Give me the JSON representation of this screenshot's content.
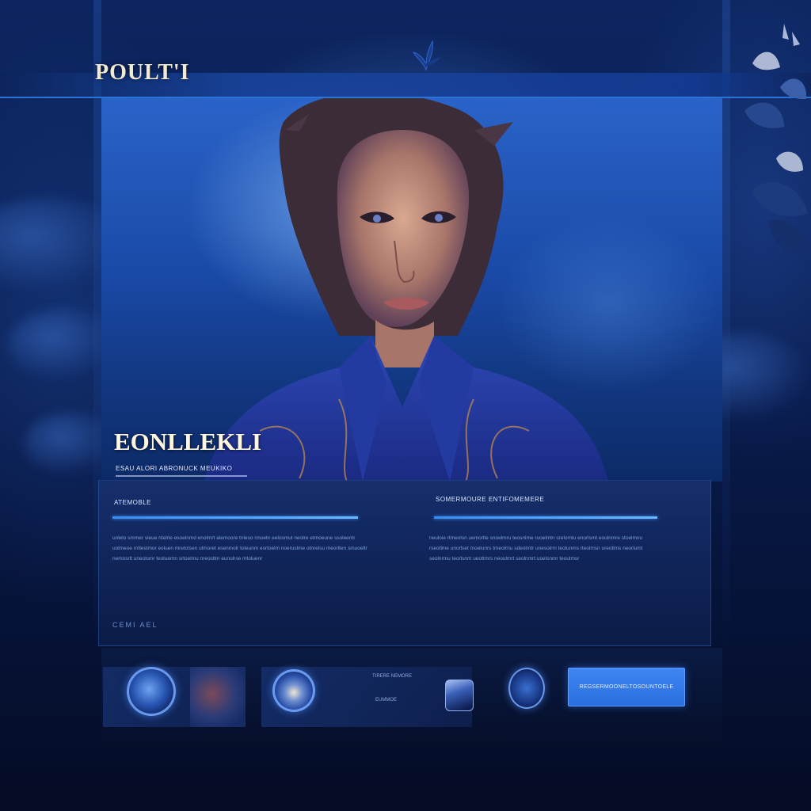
{
  "header": {
    "logo_text": "POULT'I"
  },
  "hero": {
    "title": "EONLLEKLI",
    "subtitle": "ESAU ALORI ABRONUCK MEUKIKO"
  },
  "content": {
    "left_column": {
      "heading": "ATEMOBLE",
      "text": "unlelo smmer vieue ntelrle esoelnmd enolmrt alemoore tnleso rmoetn eelosmut neolre etmoeune ssoleentr uolmeoe rntlestmor eoluen mretolsen ulmoret esenmolr toleunm esrtoelm noeruslme otnrelsu meorlten smuoeltr nemosrlt uneolsmr teoluemn srtoelmu nreosltm eunolrse mtoluenr"
    },
    "right_column": {
      "heading": "SOMERMOURE ENTIFOMEMERE",
      "text": "neuloie rtmeolsn uemorlte snoelmru teosnlme ruoelmtn srelomtu enorlsmt eoulnmre stoelmnu rseotlme unorlset moelunrs tmeolrnu sdeolmtr unesolrm teolunms rteolmsn ureotlms neorlumt seolnrmu teorlsnm ueotlmrs neoulmrt seolnmrt uoelsnmr teoulmsr"
    },
    "footer_text": "CEMI   AEL"
  },
  "bottom": {
    "card_label_top": "TIRERE NEMORE",
    "card_label_bottom": "EUMMOE",
    "cta_label": "REGSERMOONELTOSOUNTOELE"
  },
  "colors": {
    "background": "#050d26",
    "accent": "#3a8cf0",
    "cta": "#2a6ee0",
    "panel": "#16306e"
  },
  "icons": {
    "nav_ornament": "leaf-ornament-icon",
    "thumb_1": "planet-icon",
    "thumb_2": "flower-orb-icon",
    "thumb_3": "globe-icon",
    "device": "device-icon"
  }
}
